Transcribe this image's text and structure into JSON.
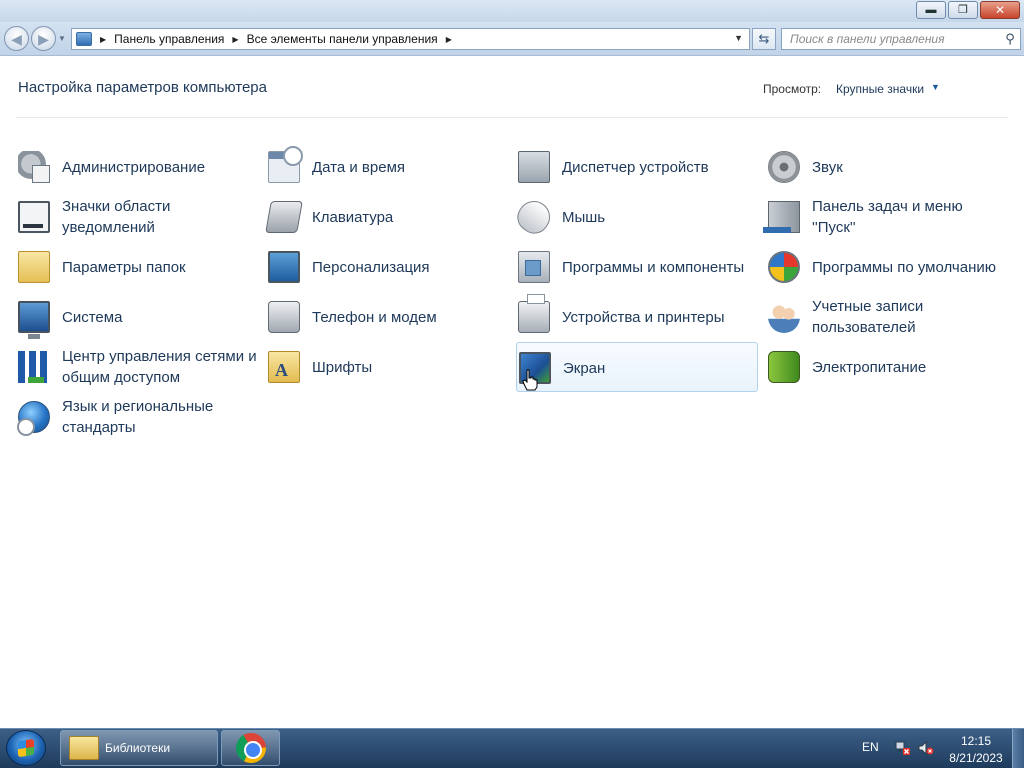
{
  "address_bar": {
    "crumbs": [
      "Панель управления",
      "Все элементы панели управления"
    ],
    "search_placeholder": "Поиск в панели управления"
  },
  "header": {
    "title": "Настройка параметров компьютера",
    "view_label": "Просмотр:",
    "view_value": "Крупные значки"
  },
  "items": [
    {
      "label": "Администрирование",
      "icon": "administrative-tools-icon"
    },
    {
      "label": "Дата и время",
      "icon": "date-time-icon"
    },
    {
      "label": "Диспетчер устройств",
      "icon": "device-manager-icon"
    },
    {
      "label": "Звук",
      "icon": "sound-icon"
    },
    {
      "label": "Значки области уведомлений",
      "icon": "notification-area-icon"
    },
    {
      "label": "Клавиатура",
      "icon": "keyboard-icon"
    },
    {
      "label": "Мышь",
      "icon": "mouse-icon"
    },
    {
      "label": "Панель задач и меню ''Пуск''",
      "icon": "taskbar-start-menu-icon"
    },
    {
      "label": "Параметры папок",
      "icon": "folder-options-icon"
    },
    {
      "label": "Персонализация",
      "icon": "personalization-icon"
    },
    {
      "label": "Программы и компоненты",
      "icon": "programs-features-icon"
    },
    {
      "label": "Программы по умолчанию",
      "icon": "default-programs-icon"
    },
    {
      "label": "Система",
      "icon": "system-icon"
    },
    {
      "label": "Телефон и модем",
      "icon": "phone-modem-icon"
    },
    {
      "label": "Устройства и принтеры",
      "icon": "devices-printers-icon"
    },
    {
      "label": "Учетные записи пользователей",
      "icon": "user-accounts-icon"
    },
    {
      "label": "Центр управления сетями и общим доступом",
      "icon": "network-sharing-icon"
    },
    {
      "label": "Шрифты",
      "icon": "fonts-icon"
    },
    {
      "label": "Экран",
      "icon": "display-icon"
    },
    {
      "label": "Электропитание",
      "icon": "power-options-icon"
    },
    {
      "label": "Язык и региональные стандарты",
      "icon": "region-language-icon"
    }
  ],
  "taskbar": {
    "libraries_label": "Библиотеки",
    "language": "EN",
    "time": "12:15",
    "date": "8/21/2023"
  }
}
